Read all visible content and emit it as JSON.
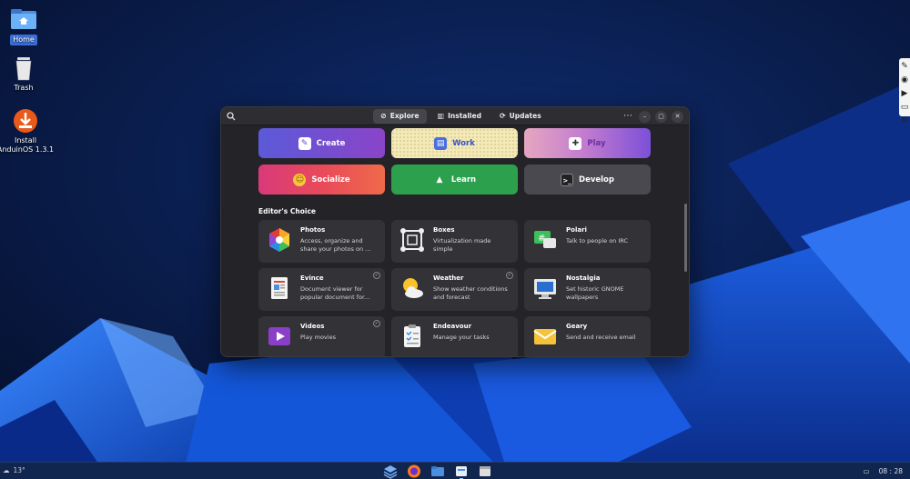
{
  "desktop": {
    "icons": [
      {
        "label": "Home"
      },
      {
        "label": "Trash"
      },
      {
        "label": "Install AnduinOS 1.3.1"
      }
    ]
  },
  "window": {
    "tabs": [
      {
        "label": "Explore",
        "icon": "compass-icon",
        "active": true
      },
      {
        "label": "Installed",
        "icon": "library-icon"
      },
      {
        "label": "Updates",
        "icon": "refresh-icon"
      }
    ],
    "categories": [
      {
        "label": "Create",
        "icon": "palette-icon"
      },
      {
        "label": "Work",
        "icon": "briefcase-icon"
      },
      {
        "label": "Play",
        "icon": "gamepad-icon"
      },
      {
        "label": "Socialize",
        "icon": "smiley-icon"
      },
      {
        "label": "Learn",
        "icon": "graduation-icon"
      },
      {
        "label": "Develop",
        "icon": "terminal-icon"
      }
    ],
    "section_title": "Editor's Choice",
    "apps": [
      {
        "name": "Photos",
        "desc": "Access, organize and share your photos on ...",
        "icon": "photos-icon",
        "installed": false
      },
      {
        "name": "Boxes",
        "desc": "Virtualization made simple",
        "icon": "boxes-icon",
        "installed": false
      },
      {
        "name": "Polari",
        "desc": "Talk to people on IRC",
        "icon": "chat-icon",
        "installed": false
      },
      {
        "name": "Evince",
        "desc": "Document viewer for popular document for...",
        "icon": "document-icon",
        "installed": true
      },
      {
        "name": "Weather",
        "desc": "Show weather conditions and forecast",
        "icon": "weather-icon",
        "installed": true
      },
      {
        "name": "Nostalgia",
        "desc": "Set historic GNOME wallpapers",
        "icon": "monitor-icon",
        "installed": false
      },
      {
        "name": "Videos",
        "desc": "Play movies",
        "icon": "play-icon",
        "installed": true
      },
      {
        "name": "Endeavour",
        "desc": "Manage your tasks",
        "icon": "tasks-icon",
        "installed": false
      },
      {
        "name": "Geary",
        "desc": "Send and receive email",
        "icon": "mail-icon",
        "installed": false
      }
    ]
  },
  "taskbar": {
    "weather": "13°",
    "time": "08 : 28"
  }
}
